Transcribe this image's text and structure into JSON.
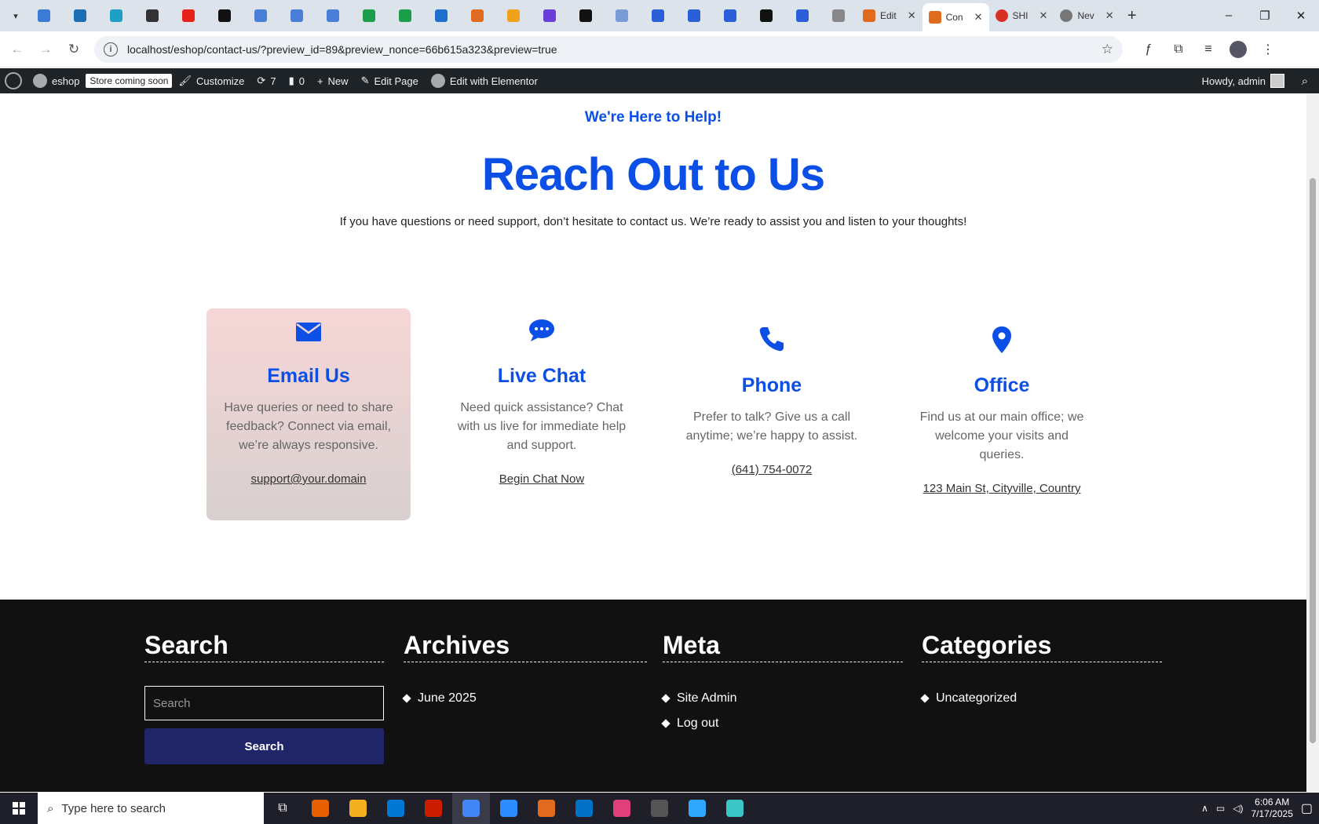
{
  "browser": {
    "tabs": [
      {
        "title": "Edit",
        "color": "#e06b1f"
      },
      {
        "title": "Con",
        "color": "#e06b1f",
        "active": true
      },
      {
        "title": "SHI",
        "color": "#d93025"
      },
      {
        "title": "Nev",
        "color": "#777777"
      }
    ],
    "pinned_icon_colors": [
      "#3a7bd5",
      "#1a6fb5",
      "#1ea0c4",
      "#333333",
      "#e62117",
      "#111111",
      "#4a7fd8",
      "#4a7fd8",
      "#4a7fd8",
      "#1b9e4b",
      "#1b9e4b",
      "#1f6fd1",
      "#e06b1f",
      "#f0a31a",
      "#6a3fd8",
      "#111111",
      "#7a9cd6",
      "#2b5fd8",
      "#2b5fd8",
      "#2b5fd8",
      "#111111",
      "#2b5fd8",
      "#888888"
    ],
    "url": "localhost/eshop/contact-us/?preview_id=89&preview_nonce=66b615a323&preview=true"
  },
  "adminbar": {
    "site": "eshop",
    "badge": "Store coming soon",
    "customize": "Customize",
    "updates": "7",
    "comments": "0",
    "new": "New",
    "edit_page": "Edit Page",
    "elementor": "Edit with Elementor",
    "howdy": "Howdy, admin"
  },
  "hero": {
    "eyebrow": "We're Here to Help!",
    "headline": "Reach Out to Us",
    "intro": "If you have questions or need support, don’t hesitate to contact us. We’re ready to assist you and listen to your thoughts!"
  },
  "cards": [
    {
      "icon": "envelope-icon",
      "title": "Email Us",
      "text": "Have queries or need to share feedback? Connect via email, we’re always responsive.",
      "link": "support@your.domain"
    },
    {
      "icon": "chat-icon",
      "title": "Live Chat",
      "text": "Need quick assistance? Chat with us live for immediate help and support.",
      "link": "Begin Chat Now"
    },
    {
      "icon": "phone-icon",
      "title": "Phone",
      "text": "Prefer to talk? Give us a call anytime; we’re happy to assist.",
      "link": "(641) 754-0072"
    },
    {
      "icon": "map-pin-icon",
      "title": "Office",
      "text": "Find us at our main office; we welcome your visits and queries.",
      "link": "123 Main St, Cityville, Country"
    }
  ],
  "footer": {
    "search": {
      "title": "Search",
      "placeholder": "Search",
      "button": "Search"
    },
    "archives": {
      "title": "Archives",
      "items": [
        "June 2025"
      ]
    },
    "meta": {
      "title": "Meta",
      "items": [
        "Site Admin",
        "Log out"
      ]
    },
    "categories": {
      "title": "Categories",
      "items": [
        "Uncategorized"
      ]
    }
  },
  "taskbar": {
    "search_placeholder": "Type here to search",
    "time": "6:06 AM",
    "date": "7/17/2025",
    "app_colors": [
      "#e66000",
      "#f2b01e",
      "#0078d4",
      "#cc1d00",
      "#4285f4",
      "#2d8cff",
      "#e06b1f",
      "#0072c6",
      "#e0407a",
      "#555555",
      "#31a8ff",
      "#3dc6c6"
    ]
  },
  "colors": {
    "accent": "#0b4fe6",
    "footer_bg": "#111111",
    "button_bg": "#1f2566"
  }
}
